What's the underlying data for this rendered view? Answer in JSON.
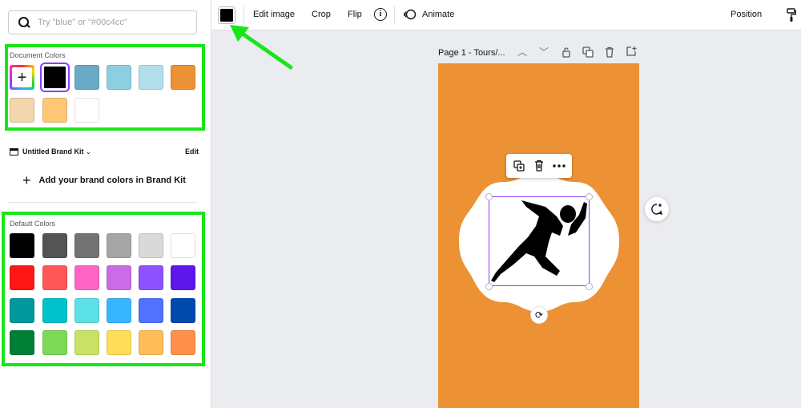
{
  "search": {
    "placeholder": "Try \"blue\" or \"#00c4cc\""
  },
  "document_colors": {
    "title": "Document Colors",
    "swatches": [
      "#000000",
      "#6aaac4",
      "#8ccfe0",
      "#b2dfe9",
      "#ec9235",
      "#f3d6ac",
      "#fec776",
      "#ffffff"
    ]
  },
  "brand_kit": {
    "name": "Untitled Brand Kit",
    "edit_label": "Edit",
    "add_label": "Add your brand colors in Brand Kit"
  },
  "default_colors": {
    "title": "Default Colors",
    "swatches": [
      "#000000",
      "#545454",
      "#737373",
      "#a6a6a6",
      "#d9d9d9",
      "#ffffff",
      "#ff1616",
      "#ff5757",
      "#ff66c4",
      "#cb6ce6",
      "#8c52ff",
      "#5e17eb",
      "#03989e",
      "#00c2cb",
      "#5ce1e6",
      "#38b6ff",
      "#5271ff",
      "#004aad",
      "#008037",
      "#7ed957",
      "#c9e265",
      "#ffde59",
      "#ffbd59",
      "#ff914d"
    ]
  },
  "toolbar": {
    "current_color": "#000000",
    "edit_image": "Edit image",
    "crop": "Crop",
    "flip": "Flip",
    "info": "i",
    "animate": "Animate",
    "position": "Position"
  },
  "page": {
    "title": "Page 1 - Tours/...",
    "background": "#ec9235"
  },
  "colors": {
    "highlight": "#19e619",
    "selection": "#8b3dff"
  }
}
